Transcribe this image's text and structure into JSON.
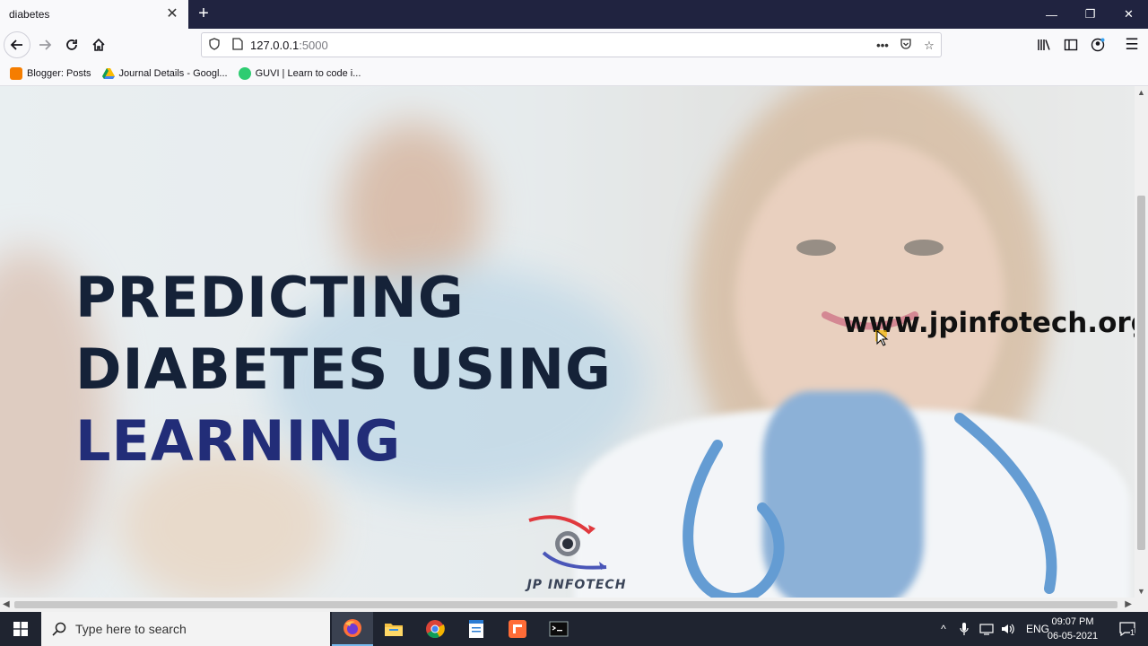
{
  "browser": {
    "tab_title": "diabetes",
    "url_host": "127.0.0.1",
    "url_port": ":5000",
    "bookmarks": [
      {
        "label": "Blogger: Posts",
        "color": "#f57d00"
      },
      {
        "label": "Journal Details - Googl...",
        "color": "#4285f4"
      },
      {
        "label": "GUVI | Learn to code i...",
        "color": "#2ecc71"
      }
    ]
  },
  "page": {
    "headline_line1": "PREDICTING",
    "headline_line2": "DIABETES USING",
    "headline_line3": "LEARNING",
    "watermark_url": "www.jpinfotech.org",
    "logo_text": "JP INFOTECH"
  },
  "taskbar": {
    "search_placeholder": "Type here to search",
    "language": "ENG",
    "time": "09:07 PM",
    "date": "06-05-2021",
    "notification_count": "1",
    "apps": [
      "firefox-icon",
      "file-explorer-icon",
      "chrome-icon",
      "notepad-icon",
      "sublime-icon",
      "terminal-icon"
    ]
  },
  "colors": {
    "headline": "#152238",
    "accent": "#222d78",
    "titlebar": "#202340",
    "taskbar": "#1f2430"
  }
}
